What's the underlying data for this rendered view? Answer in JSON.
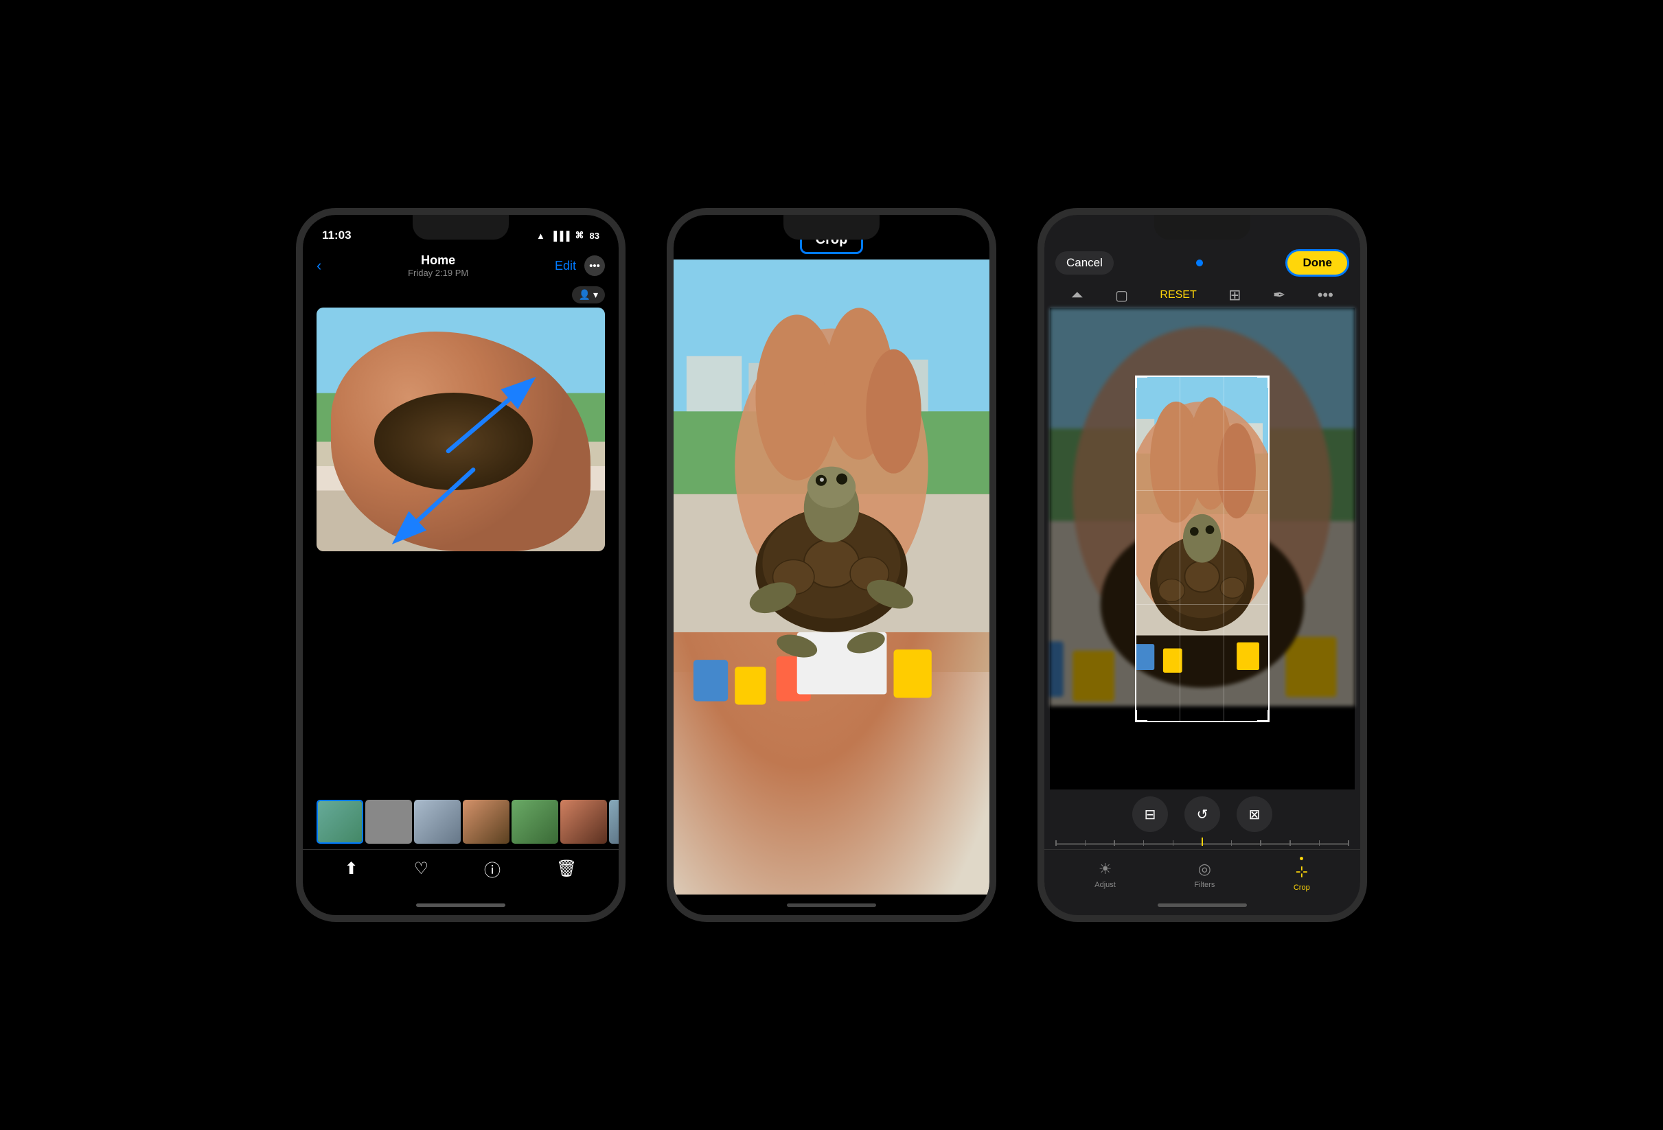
{
  "phone1": {
    "status": {
      "time": "11:03",
      "location_icon": "►",
      "signal": "▐▐▐",
      "wifi": "wifi",
      "battery": "83"
    },
    "nav": {
      "back_label": "‹",
      "title": "Home",
      "subtitle": "Friday  2:19 PM",
      "edit_label": "Edit",
      "more_icon": "•••"
    },
    "person_icon": "👤 ▾",
    "bottom_toolbar": {
      "share": "⬆",
      "like": "♡",
      "info": "ⓘ",
      "delete": "🗑"
    }
  },
  "phone2": {
    "header": {
      "crop_label": "Crop"
    }
  },
  "phone3": {
    "header": {
      "cancel_label": "Cancel",
      "done_label": "Done"
    },
    "toolbar": {
      "perspective_icon": "⏶",
      "crop_aspect_icon": "▢",
      "reset_label": "RESET",
      "layout_icon": "⊞",
      "pen_icon": "✒",
      "more_icon": "•••"
    },
    "rotation_tools": {
      "flip_label": "⊟",
      "rotate_label": "↺",
      "flip_h_label": "⊠"
    },
    "tabs": {
      "adjust_label": "Adjust",
      "filters_label": "Filters",
      "crop_label": "Crop"
    }
  }
}
